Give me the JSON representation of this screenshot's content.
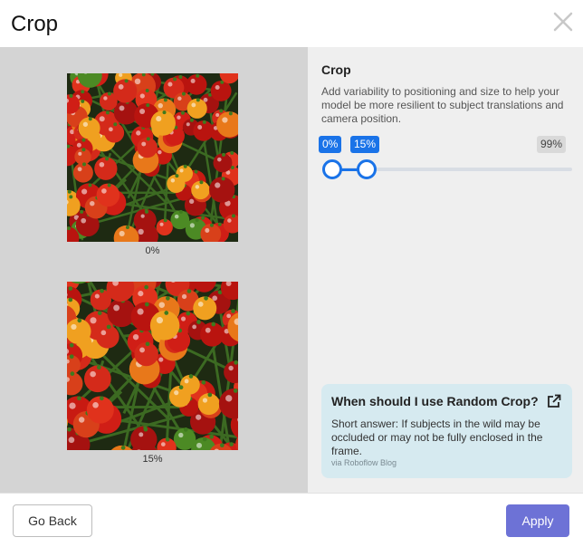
{
  "dialog": {
    "title": "Crop"
  },
  "previews": [
    {
      "caption": "0%"
    },
    {
      "caption": "15%"
    }
  ],
  "settings": {
    "heading": "Crop",
    "description": "Add variability to positioning and size to help your model be more resilient to subject translations and camera position.",
    "slider": {
      "min_label": "0%",
      "max_label": "15%",
      "limit_label": "99%",
      "min_value": 0,
      "max_value": 15,
      "limit_value": 99,
      "accent_color": "#1a73e8"
    }
  },
  "info_card": {
    "title": "When should I use Random Crop?",
    "body": "Short answer: If subjects in the wild may be occluded or may not be fully enclosed in the frame.",
    "source": "via Roboflow Blog",
    "icon": "external-link-icon"
  },
  "footer": {
    "back_label": "Go Back",
    "apply_label": "Apply",
    "apply_color": "#6d72d6"
  }
}
